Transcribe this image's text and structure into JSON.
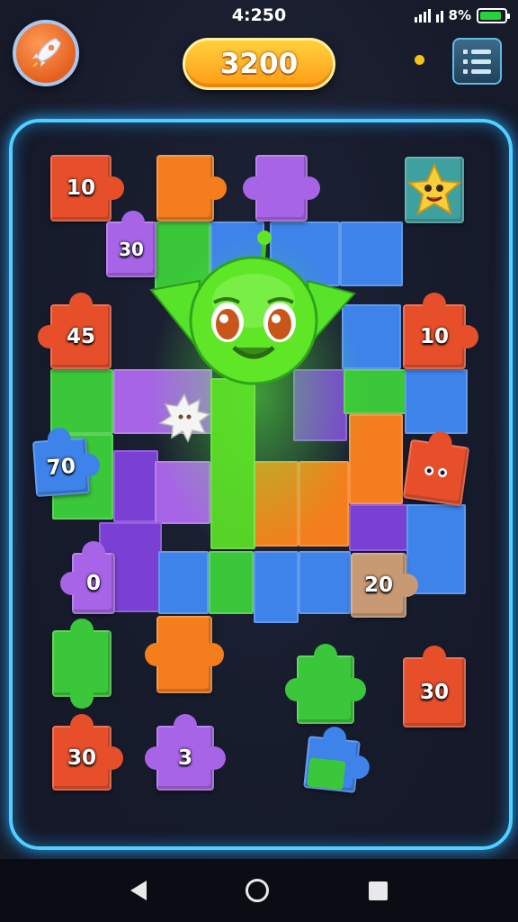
{
  "status_bar": {
    "time": "4:25",
    "time_suffix": "0",
    "battery_text": "8%",
    "battery_level": 0.9,
    "battery_color": "#28d23a"
  },
  "hud": {
    "score": "3200",
    "rocket_icon": "rocket-icon",
    "menu_icon": "menu-list-icon",
    "accent_color": "#4fd0ff",
    "score_color": "#ffb020"
  },
  "board": {
    "piece_labels": {
      "top_left": "10",
      "small_purple": "30",
      "left_mid": "45",
      "right_mid": "10",
      "blue_left": "70",
      "purple_left_low": "0",
      "tan_right": "20",
      "red_bottom_right": "30",
      "red_bottom_left": "30",
      "purple_bottom": "3"
    },
    "mascot": "green-alien-mascot",
    "star_character": "yellow-star-character",
    "badge": "white-gear-badge"
  },
  "nav": {
    "back_icon": "back-triangle-icon",
    "home_icon": "home-circle-icon",
    "recent_icon": "recent-apps-square-icon"
  }
}
